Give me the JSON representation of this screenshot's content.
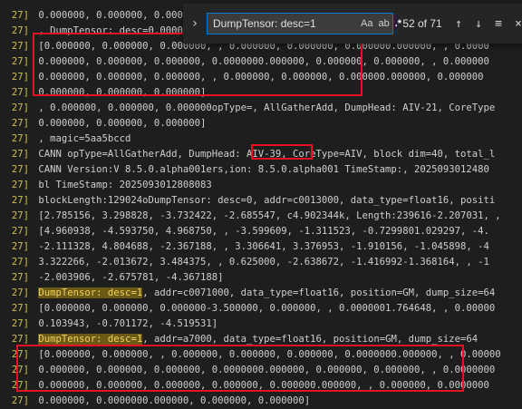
{
  "top_prefix": "g",
  "find": {
    "toggle_icon": "chevron-right-icon",
    "query": "DumpTensor: desc=1",
    "opt_case": "Aa",
    "opt_word": "ab",
    "opt_regex": ".*",
    "match_count": "52 of 71",
    "prev": "↑",
    "next": "↓",
    "selection": "≡",
    "close": "×"
  },
  "lines": [
    {
      "ln": "27]",
      "text": " 0.000000, 0.000000, 0.000000"
    },
    {
      "ln": "27]",
      "text": " , DumpTensor: desc=0.000000"
    },
    {
      "ln": "27]",
      "text": " [0.000000, 0.000000, 0.000000, , 0.000000, 0.000000, 0.000000.000000, , 0.0000"
    },
    {
      "ln": "27]",
      "text": " 0.000000, 0.000000, 0.000000, 0.0000000.000000, 0.000000, 0.000000, , 0.000000"
    },
    {
      "ln": "27]",
      "text": " 0.000000, 0.000000, 0.000000, , 0.000000, 0.000000, 0.000000.000000, 0.000000"
    },
    {
      "ln": "27]",
      "text": " 0.000000, 0.000000, 0.000000]"
    },
    {
      "ln": "27]",
      "text": " , 0.000000, 0.000000, 0.000000opType=, AllGatherAdd, DumpHead: AIV-21, CoreType"
    },
    {
      "ln": "27]",
      "text": " 0.000000, 0.000000, 0.000000]"
    },
    {
      "ln": "27]",
      "text": " , magic=5aa5bccd"
    },
    {
      "ln": "27]",
      "text": " CANN opType=AllGatherAdd, DumpHead: AIV-39, CoreType=AIV, block dim=40, total_l"
    },
    {
      "ln": "27]",
      "text": " CANN Version:V 8.5.0.alpha001ers,ion: 8.5.0.alpha001 TimeStamp:, 2025093012480"
    },
    {
      "ln": "27]",
      "text": " bl TimeStamp: 2025093012808083"
    },
    {
      "ln": "27]",
      "text": " blockLength:129024oDumpTensor: desc=0, addr=c0013000, data_type=float16, positi"
    },
    {
      "ln": "27]",
      "text": " [2.785156, 3.298828, -3.732422, -2.685547, c4.902344k, Length:239616-2.207031, ,"
    },
    {
      "ln": "27]",
      "text": " [4.960938, -4.593750, 4.968750, , -3.599609, -1.311523, -0.7299801.029297, -4."
    },
    {
      "ln": "27]",
      "text": " -2.111328, 4.804688, -2.367188, , 3.306641, 3.376953, -1.910156, -1.045898, -4"
    },
    {
      "ln": "27]",
      "text": " 3.322266, -2.013672, 3.484375, , 0.625000, -2.638672, -1.416992-1.368164, , -1"
    },
    {
      "ln": "27]",
      "text": " -2.003906, -2.675781, -4.367188]"
    },
    {
      "ln": "27]",
      "text": " DumpTensor: desc=1, addr=c0071000, data_type=float16, position=GM, dump_size=64"
    },
    {
      "ln": "27]",
      "text": " [0.000000, 0.000000, 0.000000-3.500000, 0.000000, , 0.0000001.764648, , 0.00000"
    },
    {
      "ln": "27]",
      "text": " 0.103943, -0.701172, -4.519531]"
    },
    {
      "ln": "27]",
      "text": " DumpTensor: desc=1, addr=a7000, data_type=float16, position=GM, dump_size=64"
    },
    {
      "ln": "27]",
      "text": " [0.000000, 0.000000, , 0.000000, 0.000000, 0.000000, 0.0000000.000000, , 0.00000"
    },
    {
      "ln": "27]",
      "text": " 0.000000, 0.000000, 0.000000, 0.0000000.000000, 0.000000, 0.000000, , 0.0000000"
    },
    {
      "ln": "27]",
      "text": " 0.000000, 0.000000, 0.000000, 0.000000, 0.000000.000000, , 0.000000, 0.0000000"
    },
    {
      "ln": "27]",
      "text": " 0.000000, 0.0000000.000000, 0.000000, 0.000000]"
    }
  ],
  "colors": {
    "background": "#1e1e1e",
    "line_number": "#cfc04a",
    "match_highlight": "#6b5a16",
    "annotation_red": "#e81123",
    "find_focus": "#007acc"
  }
}
